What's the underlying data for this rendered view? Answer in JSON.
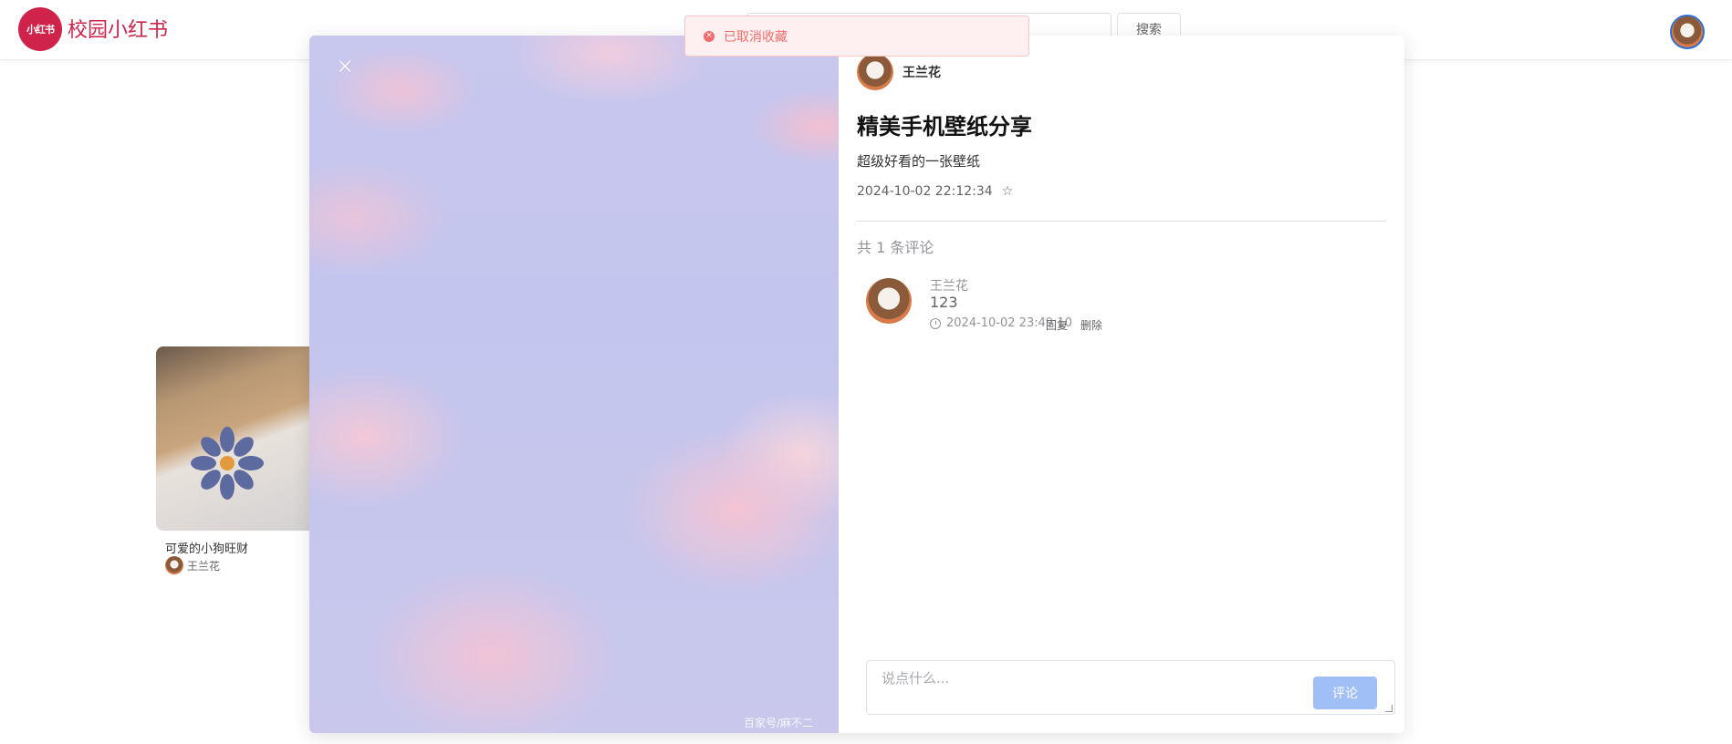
{
  "header": {
    "logo_text": "小红书",
    "site_title": "校园小红书",
    "search_placeholder": "",
    "search_button": "搜索"
  },
  "background_card": {
    "title": "可爱的小狗旺财",
    "author": "王兰花"
  },
  "modal": {
    "close_icon": "×",
    "watermark": "百家号/麻不二",
    "author": "王兰花",
    "title": "精美手机壁纸分享",
    "description": "超级好看的一张壁纸",
    "datetime": "2024-10-02 22:12:34",
    "star_icon": "☆",
    "comment_count": "共 1 条评论",
    "comments": [
      {
        "author": "王兰花",
        "text": "123",
        "datetime": "2024-10-02 23:49:10",
        "reply_label": "回复",
        "delete_label": "删除"
      }
    ],
    "comment_input_placeholder": "说点什么...",
    "comment_submit": "评论"
  },
  "toast": {
    "icon": "×",
    "message": "已取消收藏",
    "color": "#f56c6c"
  },
  "colors": {
    "brand": "#c8264a",
    "primary_disabled": "#a0bff7"
  }
}
